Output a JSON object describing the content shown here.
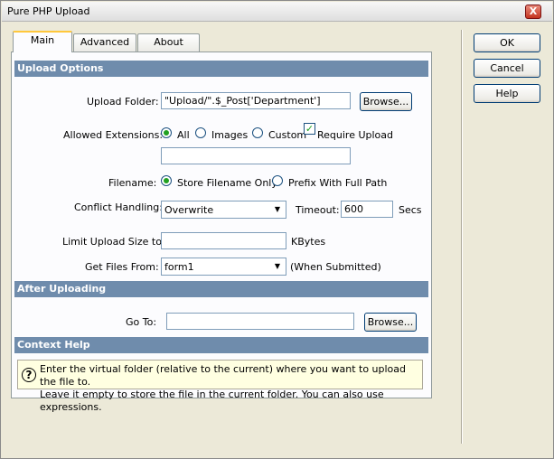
{
  "window": {
    "title": "Pure PHP Upload",
    "close_glyph": "X"
  },
  "tabs": [
    {
      "label": "Main"
    },
    {
      "label": "Advanced"
    },
    {
      "label": "About"
    }
  ],
  "buttons": {
    "ok": "OK",
    "cancel": "Cancel",
    "help": "Help"
  },
  "upload_options": {
    "header": "Upload Options",
    "upload_folder_label": "Upload Folder:",
    "upload_folder_value": "\"Upload/\".$_Post['Department']",
    "browse_label": "Browse...",
    "allowed_ext_label": "Allowed Extensions:",
    "ext_all": "All",
    "ext_images": "Images",
    "ext_custom": "Custom",
    "require_upload": "Require Upload",
    "custom_ext_value": "",
    "filename_label": "Filename:",
    "store_filename_only": "Store Filename Only",
    "prefix_full_path": "Prefix With Full Path",
    "conflict_label": "Conflict Handling:",
    "conflict_value": "Overwrite",
    "timeout_label": "Timeout:",
    "timeout_value": "600",
    "timeout_unit": "Secs",
    "limit_label": "Limit Upload Size to:",
    "limit_value": "",
    "limit_unit": "KBytes",
    "get_files_label": "Get Files From:",
    "get_files_value": "form1",
    "get_files_suffix": "(When Submitted)"
  },
  "after_uploading": {
    "header": "After Uploading",
    "goto_label": "Go To:",
    "goto_value": "",
    "browse_label": "Browse..."
  },
  "context_help": {
    "header": "Context Help",
    "icon_glyph": "?",
    "line1": "Enter the virtual folder (relative to the current) where you want to upload the file to.",
    "line2": "Leave it empty to store the file in the current folder. You can also use expressions."
  },
  "icons": {
    "dropdown": "chevron-down-icon",
    "help": "question-icon",
    "check": "checkmark-icon"
  }
}
